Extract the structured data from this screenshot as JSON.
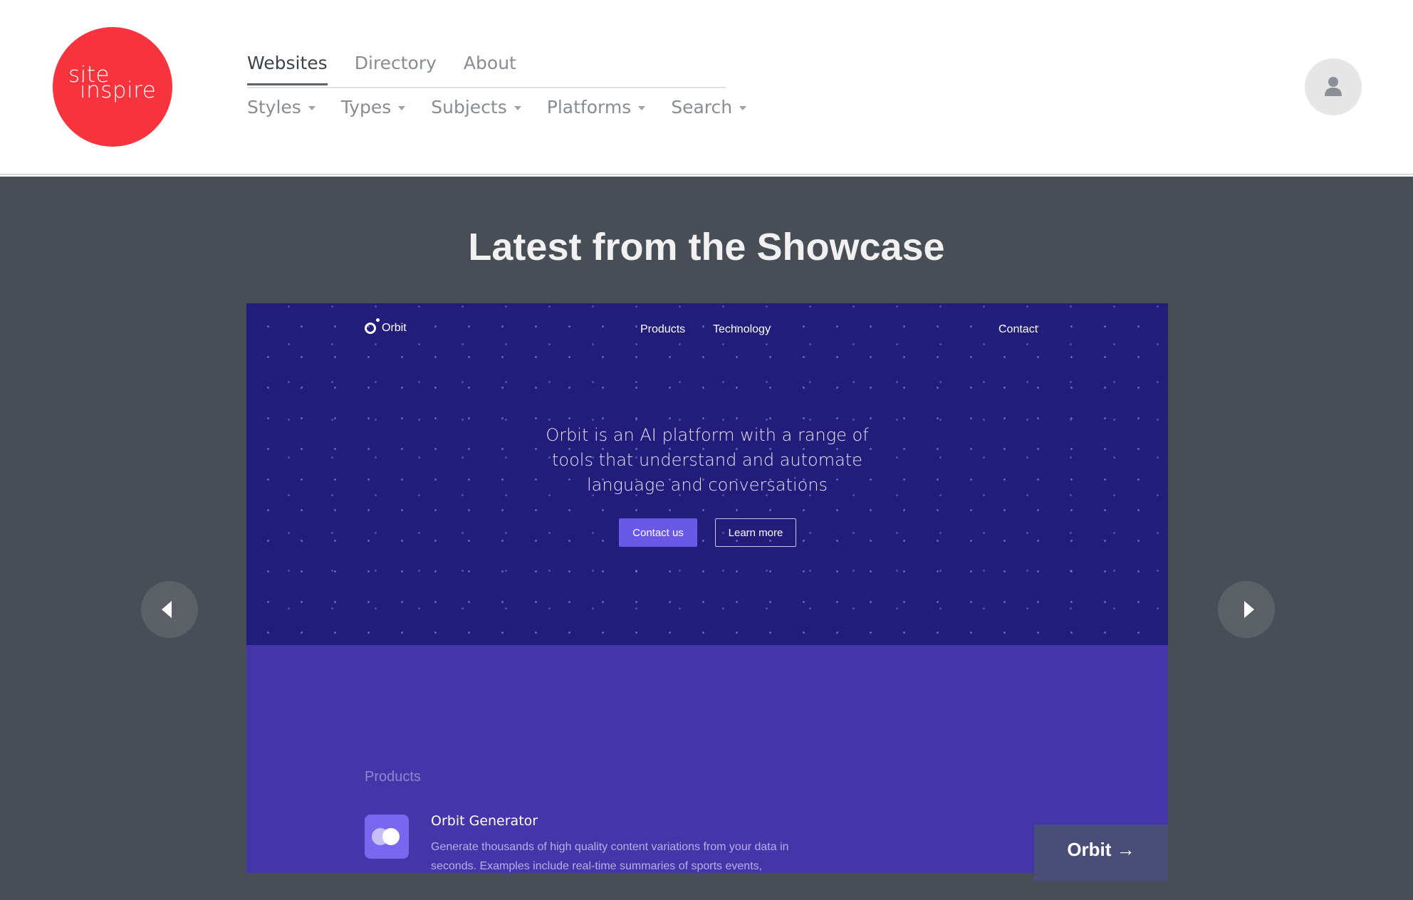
{
  "logo": {
    "line1": "site",
    "line2": "inspire"
  },
  "nav": {
    "primary": [
      "Websites",
      "Directory",
      "About"
    ],
    "secondary": [
      "Styles",
      "Types",
      "Subjects",
      "Platforms",
      "Search"
    ]
  },
  "user": {
    "icon": "user-icon"
  },
  "showcase": {
    "title": "Latest from the Showcase",
    "prev_icon": "chevron-left-icon",
    "next_icon": "chevron-right-icon"
  },
  "preview": {
    "brand": "Orbit",
    "nav": {
      "products": "Products",
      "technology": "Technology",
      "contact": "Contact"
    },
    "headline": "Orbit is an AI platform with a range of tools that understand and automate language and conversations",
    "contact_button": "Contact us",
    "learn_button": "Learn more",
    "products_label": "Products",
    "product_title": "Orbit Generator",
    "product_desc": "Generate thousands of high quality content variations from your data in seconds. Examples include real-time summaries of sports events,",
    "link_label": "Orbit →"
  },
  "colors": {
    "logo_red": "#f7333e",
    "showcase_bg": "#474e55",
    "hero_bg": "#221c7a",
    "lower_bg": "#4436a9",
    "button_purple": "#6a58e6"
  }
}
